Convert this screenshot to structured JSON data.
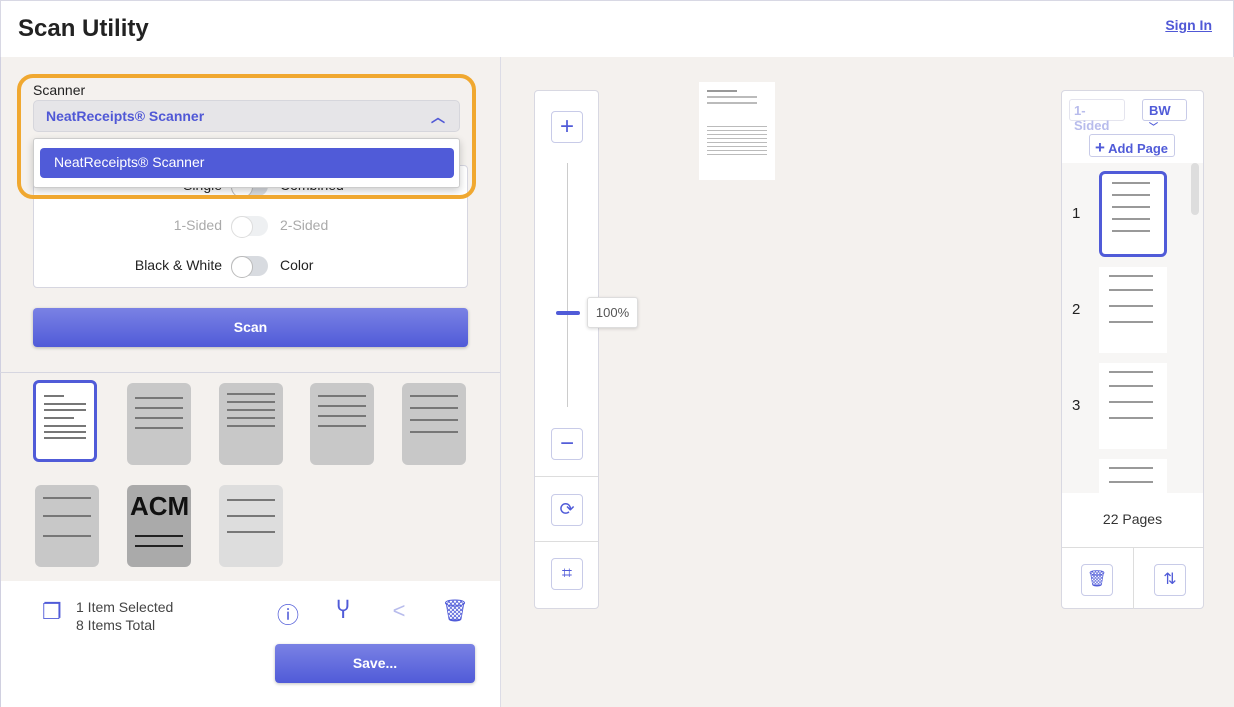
{
  "header": {
    "title": "Scan Utility",
    "sign_in": "Sign In"
  },
  "scanner": {
    "label": "Scanner",
    "selected": "NeatReceipts® Scanner",
    "options": [
      "NeatReceipts® Scanner"
    ],
    "highlight_color": "#f0a830"
  },
  "options": {
    "mode": {
      "left": "Single",
      "right": "Combined"
    },
    "sides": {
      "left": "1-Sided",
      "right": "2-Sided"
    },
    "color": {
      "left": "Black & White",
      "right": "Color"
    }
  },
  "scan_button": "Scan",
  "status": {
    "selected": "1 Item Selected",
    "total": "8 Items Total"
  },
  "save_button": "Save...",
  "zoom": {
    "level": "100%"
  },
  "right_panel": {
    "sides_select": "1-Sided",
    "color_select": "BW",
    "add_page": "Add Page",
    "pages": [
      "1",
      "2",
      "3"
    ],
    "page_count": "22 Pages"
  },
  "colors": {
    "accent": "#505bd8",
    "background": "#f4f1ee"
  }
}
